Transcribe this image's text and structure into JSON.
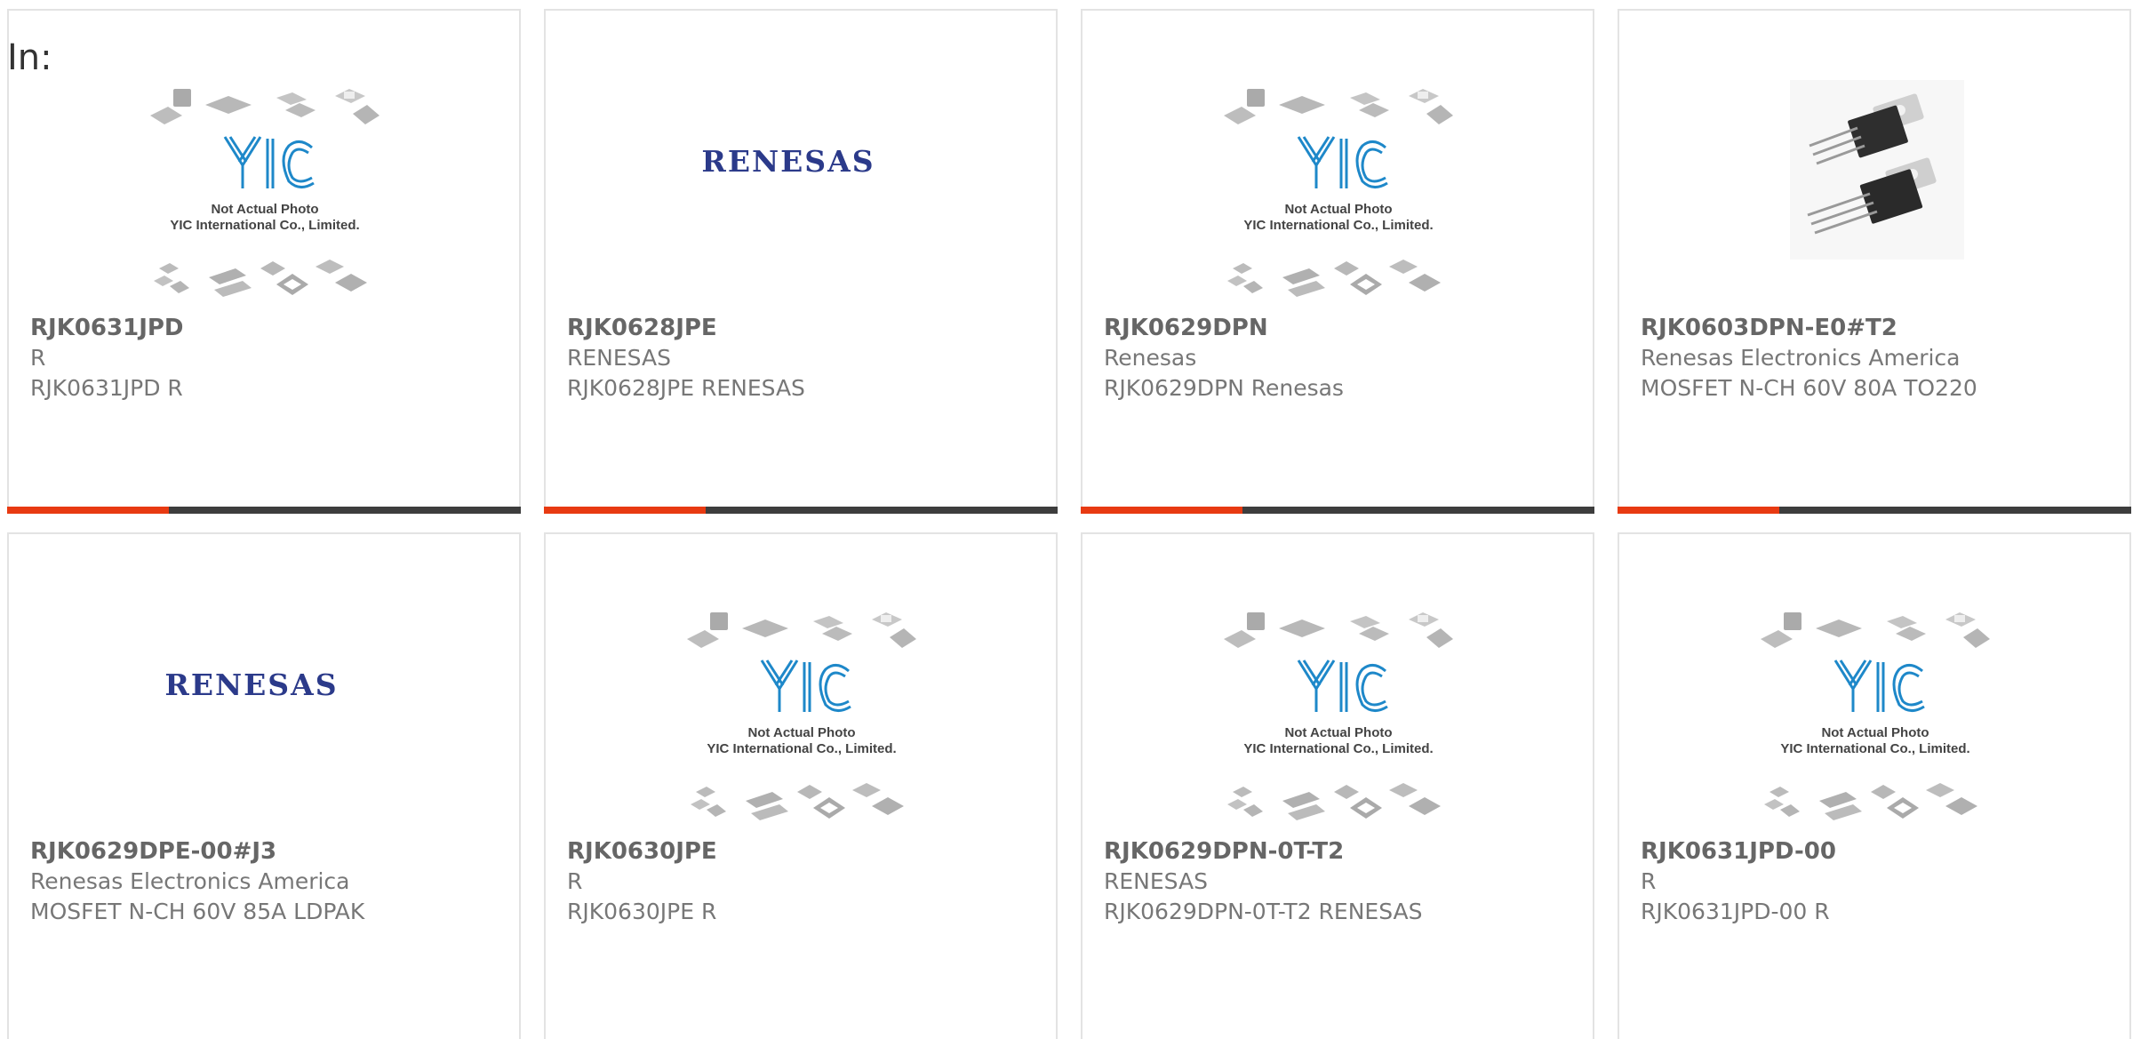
{
  "header": {
    "in_label": "In:"
  },
  "watermark": {
    "line1": "Not Actual Photo",
    "line2": "YIC International Co., Limited.",
    "logo": "YIC"
  },
  "brand_logo": "RENESAS",
  "colors": {
    "accent": "#e83a12",
    "bar": "#3d3d3d",
    "brand": "#2b3a8a",
    "yic_blue": "#1e88c9"
  },
  "products": [
    {
      "part": "RJK0631JPD",
      "manufacturer": "R",
      "description": "RJK0631JPD R",
      "image": "not-actual-photo-icon"
    },
    {
      "part": "RJK0628JPE",
      "manufacturer": "RENESAS",
      "description": "RJK0628JPE RENESAS",
      "image": "renesas-logo-icon"
    },
    {
      "part": "RJK0629DPN",
      "manufacturer": "Renesas",
      "description": "RJK0629DPN Renesas",
      "image": "not-actual-photo-icon"
    },
    {
      "part": "RJK0603DPN-E0#T2",
      "manufacturer": "Renesas Electronics America",
      "description": "MOSFET N-CH 60V 80A TO220",
      "image": "transistor-photo-icon"
    },
    {
      "part": "RJK0629DPE-00#J3",
      "manufacturer": "Renesas Electronics America",
      "description": "MOSFET N-CH 60V 85A LDPAK",
      "image": "renesas-logo-icon"
    },
    {
      "part": "RJK0630JPE",
      "manufacturer": "R",
      "description": "RJK0630JPE R",
      "image": "not-actual-photo-icon"
    },
    {
      "part": "RJK0629DPN-0T-T2",
      "manufacturer": "RENESAS",
      "description": "RJK0629DPN-0T-T2 RENESAS",
      "image": "not-actual-photo-icon"
    },
    {
      "part": "RJK0631JPD-00",
      "manufacturer": "R",
      "description": "RJK0631JPD-00 R",
      "image": "not-actual-photo-icon"
    }
  ]
}
